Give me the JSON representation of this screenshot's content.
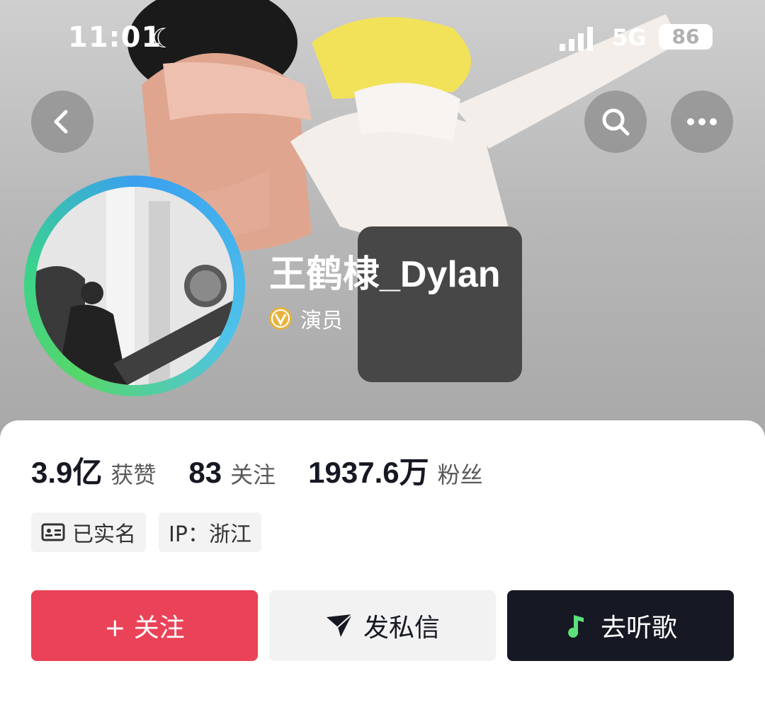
{
  "status_bar": {
    "time": "11:01",
    "network": "5G",
    "battery": "86"
  },
  "header": {
    "back_icon": "chevron-left-icon",
    "search_icon": "search-icon",
    "more_icon": "more-dots-icon"
  },
  "profile": {
    "name": "王鹤棣_Dylan",
    "verification_label": "演员",
    "verification_color": "#e8b33a"
  },
  "stats": [
    {
      "value": "3.9亿",
      "label": "获赞"
    },
    {
      "value": "83",
      "label": "关注"
    },
    {
      "value": "1937.6万",
      "label": "粉丝"
    }
  ],
  "tags": {
    "realname": "已实名",
    "ip": "IP：浙江"
  },
  "actions": {
    "follow": "+ 关注",
    "message": "发私信",
    "music": "去听歌"
  },
  "colors": {
    "follow": "#ea4257",
    "dark": "#161823"
  }
}
